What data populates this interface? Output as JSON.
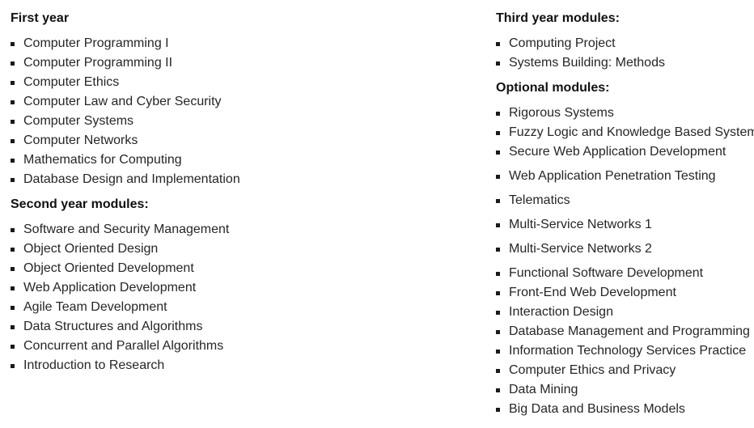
{
  "sections": {
    "first_year": {
      "heading": "First year",
      "items": [
        "Computer Programming I",
        "Computer Programming II",
        "Computer Ethics",
        "Computer Law and Cyber Security",
        "Computer Systems",
        "Computer Networks",
        "Mathematics for Computing",
        "Database Design and Implementation"
      ]
    },
    "second_year": {
      "heading": "Second year modules:",
      "items": [
        "Software and Security Management",
        "Object Oriented Design",
        "Object Oriented Development",
        "Web Application Development",
        "Agile Team Development",
        "Data Structures and Algorithms",
        "Concurrent and Parallel Algorithms",
        "Introduction to Research"
      ]
    },
    "third_year": {
      "heading": "Third year modules:",
      "items": [
        "Computing Project",
        "Systems Building: Methods"
      ]
    },
    "optional": {
      "heading": "Optional modules:",
      "items": [
        "Rigorous Systems",
        "Fuzzy Logic and Knowledge Based Systems",
        "Secure Web Application Development",
        "Web Application Penetration Testing",
        "Telematics",
        "Multi-Service Networks 1",
        "Multi-Service Networks 2",
        "Functional Software Development",
        "Front-End Web Development",
        "Interaction Design",
        "Database Management and Programming",
        "Information Technology Services Practice",
        "Computer Ethics and Privacy",
        "Data Mining",
        "Big Data and Business Models"
      ]
    }
  }
}
